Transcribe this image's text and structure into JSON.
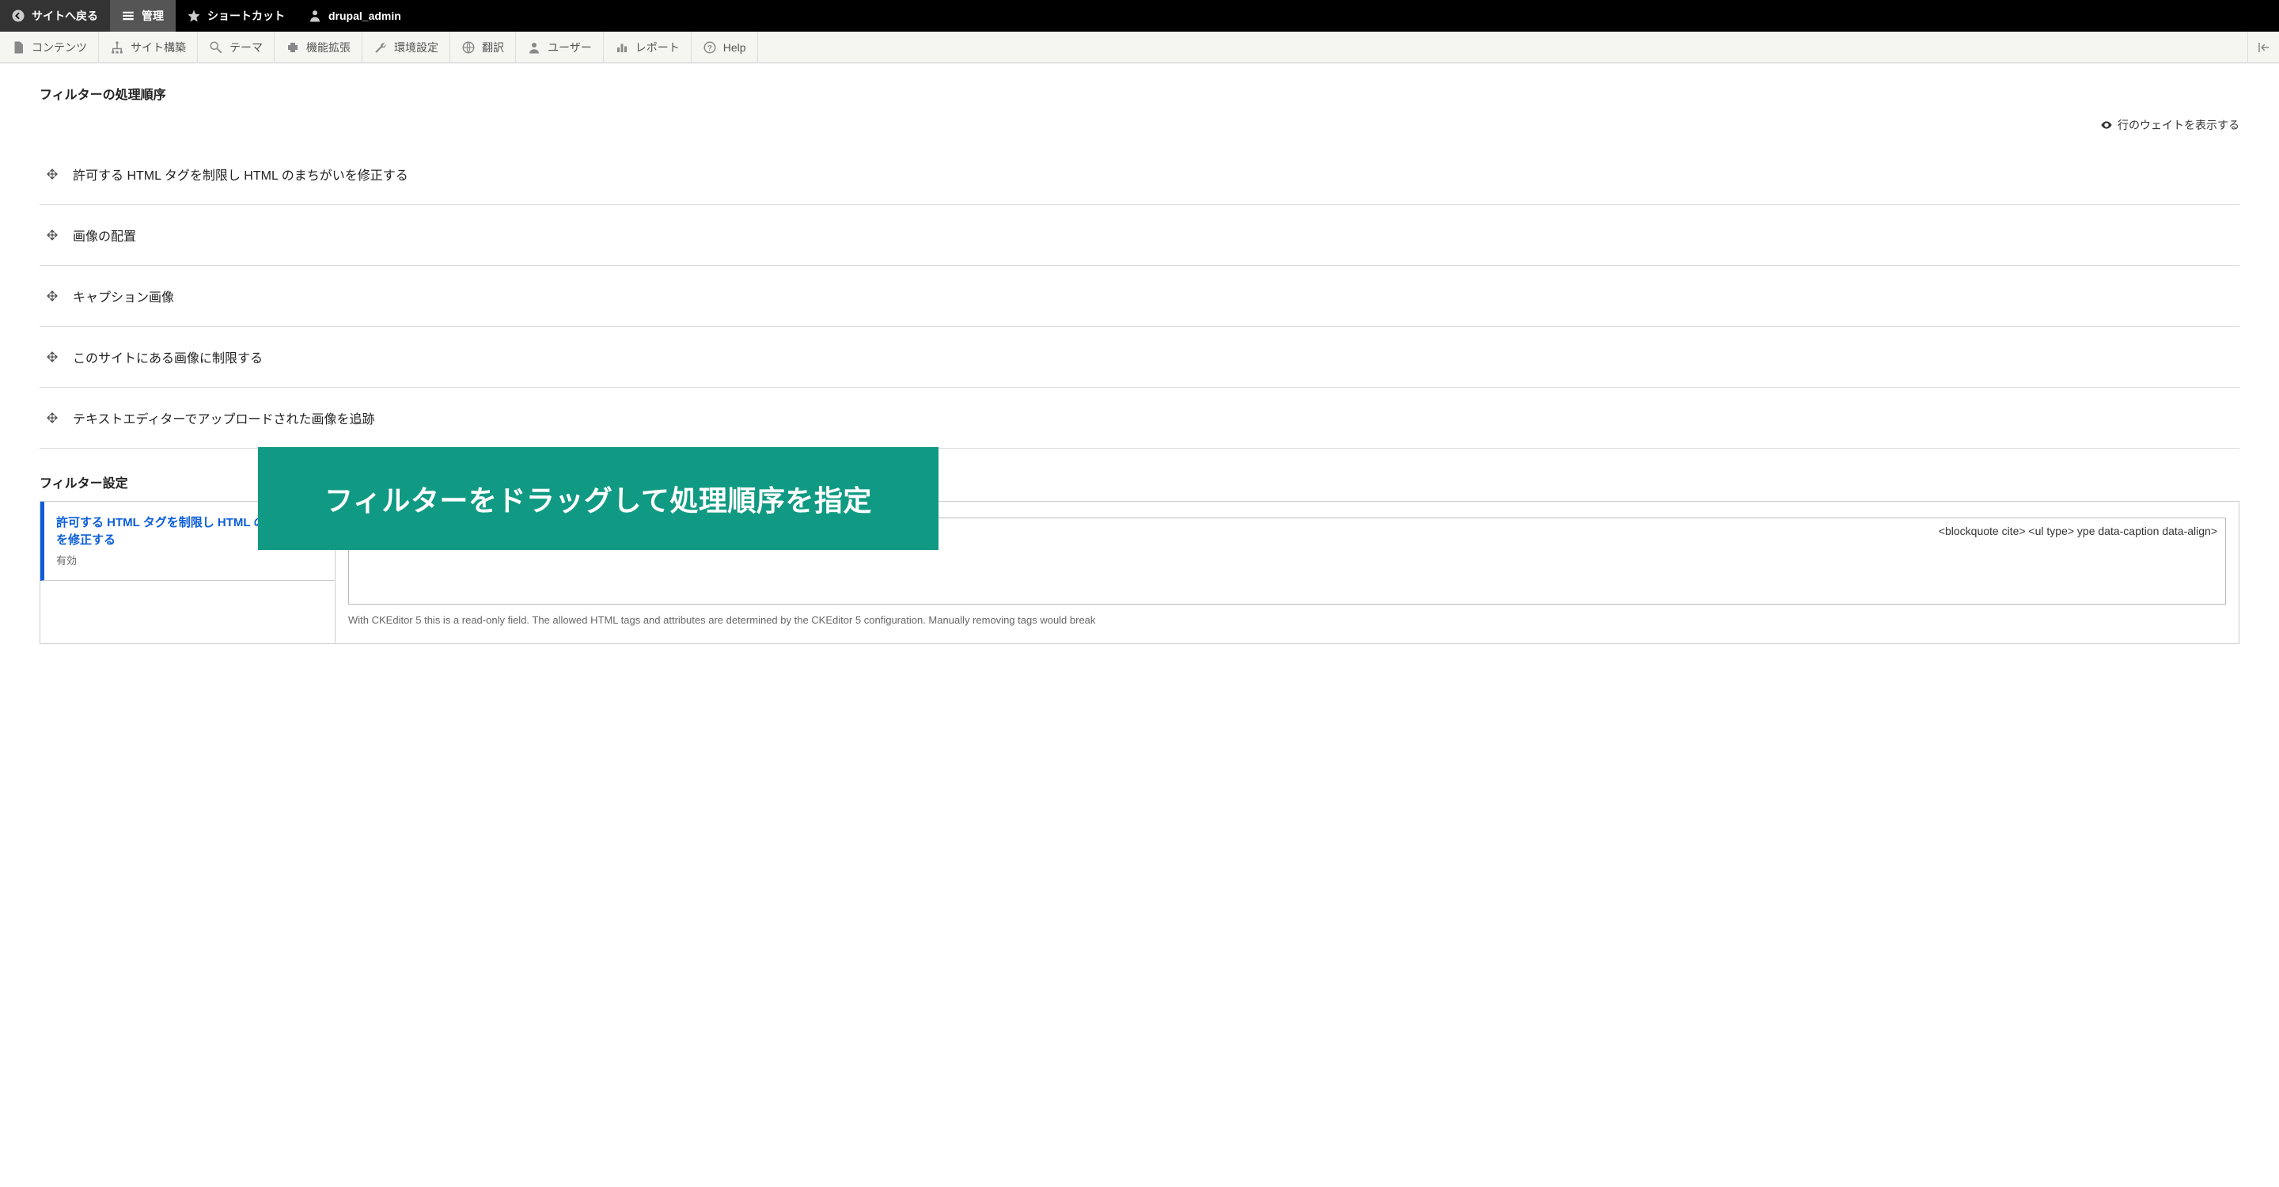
{
  "topbar": {
    "back": "サイトへ戻る",
    "admin": "管理",
    "shortcut": "ショートカット",
    "user": "drupal_admin"
  },
  "menubar": {
    "items": [
      {
        "label": "コンテンツ",
        "icon": "file"
      },
      {
        "label": "サイト構築",
        "icon": "structure"
      },
      {
        "label": "テーマ",
        "icon": "wand"
      },
      {
        "label": "機能拡張",
        "icon": "puzzle"
      },
      {
        "label": "環境設定",
        "icon": "wrench"
      },
      {
        "label": "翻訳",
        "icon": "globe"
      },
      {
        "label": "ユーザー",
        "icon": "user"
      },
      {
        "label": "レポート",
        "icon": "bar"
      },
      {
        "label": "Help",
        "icon": "help"
      }
    ]
  },
  "section_order": "フィルターの処理順序",
  "show_weights": "行のウェイトを表示する",
  "filters": [
    {
      "label": "許可する HTML タグを制限し HTML のまちがいを修正する"
    },
    {
      "label": "画像の配置"
    },
    {
      "label": "キャプション画像"
    },
    {
      "label": "このサイトにある画像に制限する"
    },
    {
      "label": "テキストエディターでアップロードされた画像を追跡"
    }
  ],
  "section_settings": "フィルター設定",
  "active_tab": {
    "title": "許可する HTML タグを制限し HTML のまちがいを修正する",
    "sub": "有効"
  },
  "allowed_html_tail": " <blockquote cite> <ul type> ype data-caption data-align>",
  "help_text": "With CKEditor 5 this is a read-only field. The allowed HTML tags and attributes are determined by the CKEditor 5 configuration. Manually removing tags would break",
  "overlay": "フィルターをドラッグして処理順序を指定"
}
